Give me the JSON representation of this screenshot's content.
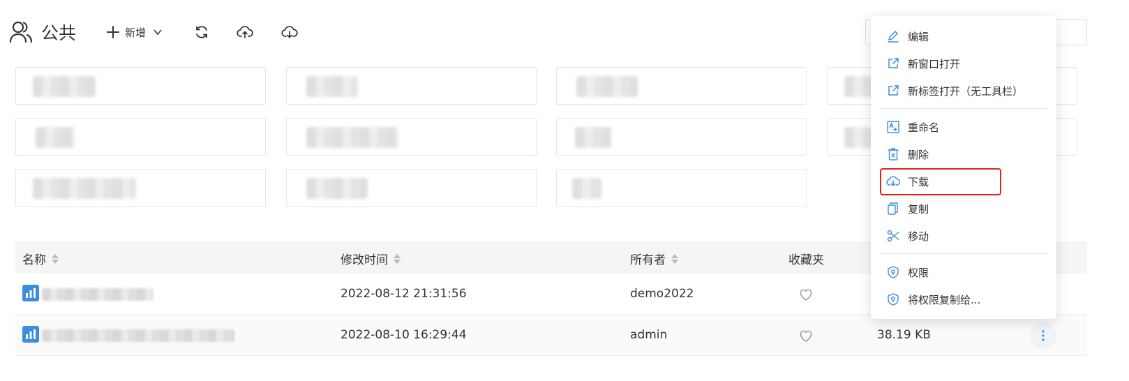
{
  "header": {
    "title": "公共",
    "new_label": "新增",
    "icons": [
      "users-icon",
      "plus-icon",
      "chevron-down-icon",
      "refresh-icon",
      "upload-cloud-icon",
      "download-cloud-icon"
    ]
  },
  "table": {
    "columns": [
      "名称",
      "修改时间",
      "所有者",
      "收藏夹"
    ],
    "rows": [
      {
        "modified": "2022-08-12 21:31:56",
        "owner": "demo2022",
        "size": ""
      },
      {
        "modified": "2022-08-10 16:29:44",
        "owner": "admin",
        "size": "38.19 KB"
      }
    ]
  },
  "context_menu": {
    "items": [
      {
        "label": "编辑",
        "icon": "edit-icon"
      },
      {
        "label": "新窗口打开",
        "icon": "external-link-icon"
      },
      {
        "label": "新标签打开（无工具栏）",
        "icon": "external-link-icon"
      },
      {
        "label": "重命名",
        "icon": "rename-icon"
      },
      {
        "label": "删除",
        "icon": "delete-icon"
      },
      {
        "label": "下载",
        "icon": "download-cloud-icon"
      },
      {
        "label": "复制",
        "icon": "copy-icon"
      },
      {
        "label": "移动",
        "icon": "scissors-icon"
      },
      {
        "label": "权限",
        "icon": "shield-icon"
      },
      {
        "label": "将权限复制给...",
        "icon": "shield-icon"
      }
    ],
    "highlighted": "下载"
  },
  "colors": {
    "accent": "#3b8ede",
    "highlight_border": "#e8201a",
    "header_bg": "#f5f5f5"
  }
}
